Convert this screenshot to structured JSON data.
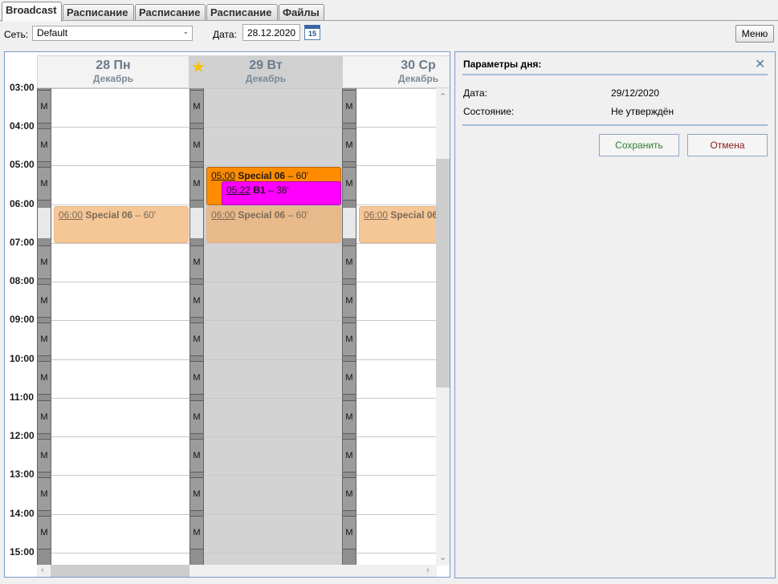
{
  "tabs": [
    "Broadcast",
    "Расписание",
    "Расписание",
    "Расписание",
    "Файлы"
  ],
  "toolbar": {
    "network_label": "Сеть:",
    "network_value": "Default",
    "date_label": "Дата:",
    "date_value": "28.12.2020",
    "calendar_day": "15",
    "menu_label": "Меню"
  },
  "calendar": {
    "days": [
      {
        "num": "28 Пн",
        "month": "Декабрь"
      },
      {
        "num": "29 Вт",
        "month": "Декабрь"
      },
      {
        "num": "30 Ср",
        "month": "Декабрь"
      }
    ],
    "star": "★",
    "times": [
      "03:00",
      "04:00",
      "05:00",
      "06:00",
      "07:00",
      "08:00",
      "09:00",
      "10:00",
      "11:00",
      "12:00",
      "13:00",
      "14:00",
      "15:00"
    ],
    "block_letter": "M",
    "events": {
      "ghost_time": "06:00",
      "ghost_title": "Special 06",
      "ghost_dur": "– 60'",
      "orange_time": "05:00",
      "orange_title": "Special 06",
      "orange_dur": "– 60'",
      "pink_time": "05:22",
      "pink_title": "B1",
      "pink_dur": "– 38'"
    }
  },
  "panel": {
    "title": "Параметры дня:",
    "date_label": "Дата:",
    "date_value": "29/12/2020",
    "state_label": "Состояние:",
    "state_value": "Не утверждён",
    "save_label": "Сохранить",
    "cancel_label": "Отмена",
    "save_color": "#2e7d32",
    "cancel_color": "#8b1a1a"
  }
}
